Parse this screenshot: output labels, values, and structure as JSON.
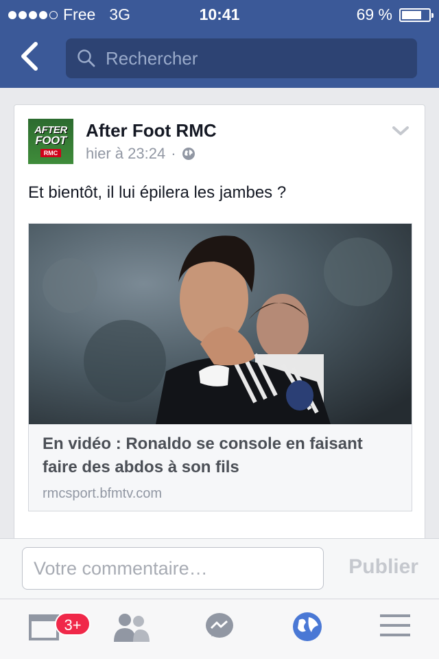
{
  "status_bar": {
    "carrier": "Free",
    "network": "3G",
    "time": "10:41",
    "battery": "69 %",
    "signal_bars": 4
  },
  "nav": {
    "search_placeholder": "Rechercher",
    "back_icon": "chevron-left-icon"
  },
  "post": {
    "author": "After Foot RMC",
    "avatar_text_1": "AFTER",
    "avatar_text_2": "FOOT",
    "avatar_text_3": "RMC",
    "timestamp": "hier à 23:24",
    "separator": "·",
    "privacy_icon": "globe-icon",
    "text": "Et bientôt, il lui épilera les jambes ?",
    "link": {
      "title": "En vidéo : Ronaldo se console en faisant faire des abdos à son fils",
      "domain": "rmcsport.bfmtv.com"
    }
  },
  "comment": {
    "placeholder": "Votre commentaire…",
    "publish_label": "Publier"
  },
  "tabs": {
    "items": [
      "news-feed-icon",
      "friends-icon",
      "messenger-icon",
      "globe-icon",
      "menu-icon"
    ],
    "badge": "3+"
  },
  "colors": {
    "brand": "#3b5998",
    "badge": "#f02849",
    "active_tab": "#4a78d5"
  }
}
